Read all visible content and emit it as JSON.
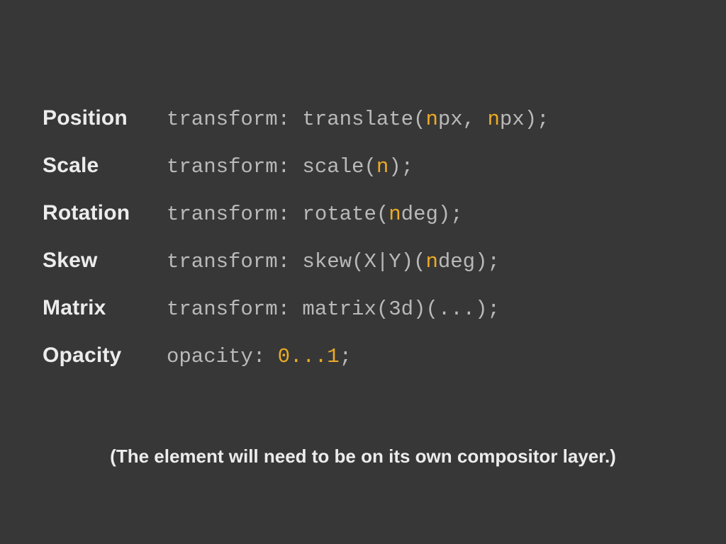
{
  "rows": [
    {
      "label": "Position",
      "tokens": [
        [
          "t",
          "transform: translate("
        ],
        [
          "v",
          "n"
        ],
        [
          "t",
          "px, "
        ],
        [
          "v",
          "n"
        ],
        [
          "t",
          "px);"
        ]
      ]
    },
    {
      "label": "Scale",
      "tokens": [
        [
          "t",
          "transform: scale("
        ],
        [
          "v",
          "n"
        ],
        [
          "t",
          ");"
        ]
      ]
    },
    {
      "label": "Rotation",
      "tokens": [
        [
          "t",
          "transform: rotate("
        ],
        [
          "v",
          "n"
        ],
        [
          "t",
          "deg);"
        ]
      ]
    },
    {
      "label": "Skew",
      "tokens": [
        [
          "t",
          "transform: skew(X|Y)("
        ],
        [
          "v",
          "n"
        ],
        [
          "t",
          "deg);"
        ]
      ]
    },
    {
      "label": "Matrix",
      "tokens": [
        [
          "t",
          "transform: matrix(3d)(...);"
        ]
      ]
    },
    {
      "label": "Opacity",
      "tokens": [
        [
          "t",
          "opacity: "
        ],
        [
          "v",
          "0...1"
        ],
        [
          "t",
          ";"
        ]
      ]
    }
  ],
  "footnote": "(The element will need to be on its own compositor layer.)"
}
